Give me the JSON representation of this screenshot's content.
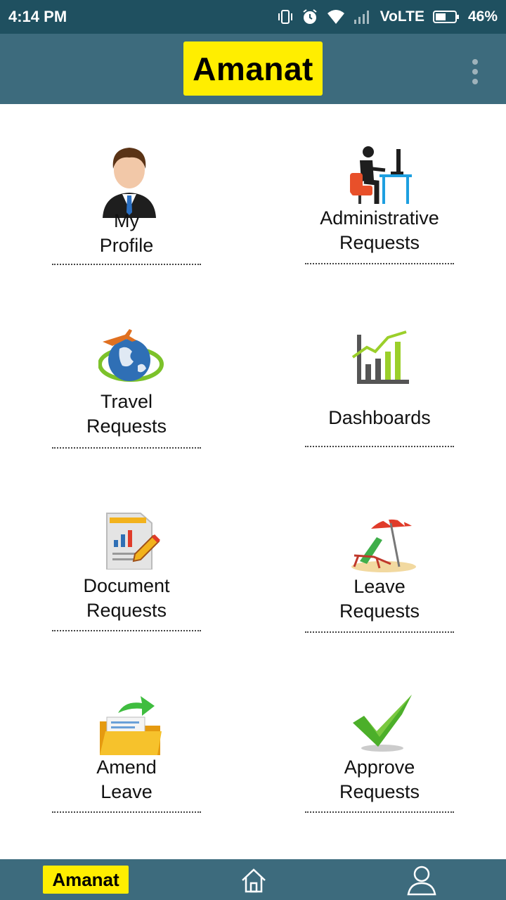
{
  "status_bar": {
    "time": "4:14 PM",
    "network": "VoLTE",
    "battery": "46%",
    "icons": [
      "vibrate-icon",
      "alarm-icon",
      "wifi-icon",
      "signal-icon",
      "battery-icon"
    ]
  },
  "app_bar": {
    "logo_text": "Amanat",
    "menu_icon": "more-vert-icon"
  },
  "colors": {
    "status_bar": "#1f5060",
    "app_bar": "#3d6b7d",
    "logo_bg": "#ffee00"
  },
  "tiles": [
    {
      "line1": "My",
      "line2": "Profile",
      "icon": "user-profile-icon"
    },
    {
      "line1": "Administrative",
      "line2": "Requests",
      "icon": "office-desk-icon"
    },
    {
      "line1": "Travel",
      "line2": "Requests",
      "icon": "airplane-globe-icon"
    },
    {
      "line1": "Dashboards",
      "line2": "",
      "icon": "bar-chart-icon"
    },
    {
      "line1": "Document",
      "line2": "Requests",
      "icon": "document-chart-icon"
    },
    {
      "line1": "Leave",
      "line2": "Requests",
      "icon": "beach-chair-icon"
    },
    {
      "line1": "Amend",
      "line2": "Leave",
      "icon": "folder-arrow-icon"
    },
    {
      "line1": "Approve",
      "line2": "Requests",
      "icon": "checkmark-icon"
    }
  ],
  "bottom_nav": {
    "logo_text": "Amanat",
    "home_icon": "home-icon",
    "profile_icon": "person-icon"
  }
}
